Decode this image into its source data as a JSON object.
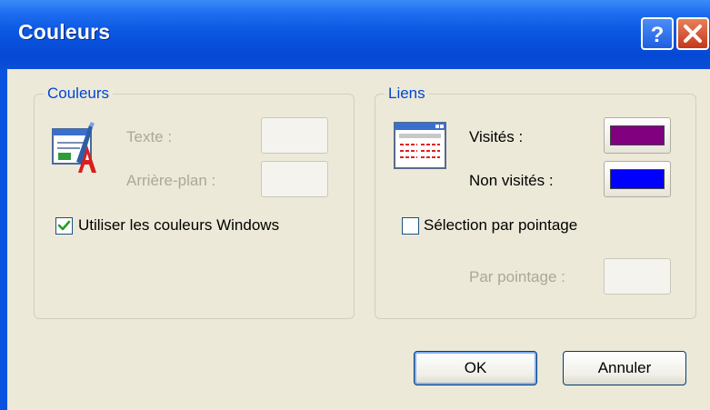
{
  "window": {
    "title": "Couleurs"
  },
  "colors_group": {
    "title": "Couleurs",
    "text_label": "Texte :",
    "background_label": "Arrière-plan :",
    "use_windows_colors_label": "Utiliser les couleurs Windows",
    "use_windows_colors_checked": true
  },
  "links_group": {
    "title": "Liens",
    "visited_label": "Visités :",
    "visited_color": "#800080",
    "unvisited_label": "Non visités :",
    "unvisited_color": "#0000ff",
    "hover_checkbox_label": "Sélection par pointage",
    "hover_checkbox_checked": false,
    "hover_label": "Par pointage :"
  },
  "buttons": {
    "ok": "OK",
    "cancel": "Annuler"
  },
  "icons": {
    "colors_icon": "text-color-palette-icon",
    "links_icon": "web-page-icon",
    "help": "help-icon",
    "close": "close-icon"
  }
}
